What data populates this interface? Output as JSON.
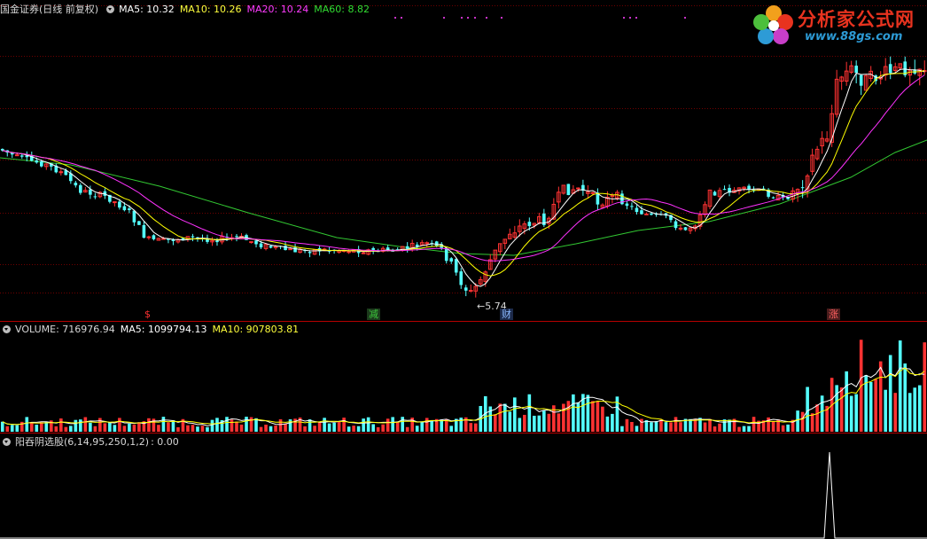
{
  "main_header": {
    "title": "国金证券(日线 前复权)",
    "ma5": "MA5: 10.32",
    "ma10": "MA10: 10.26",
    "ma20": "MA20: 10.24",
    "ma60": "MA60: 8.82"
  },
  "vol_header": {
    "title": "VOLUME: 716976.94",
    "ma5": "MA5: 1099794.13",
    "ma10": "MA10: 907803.81"
  },
  "ind_header": {
    "title": "阳吞阴选股(6,14,95,250,1,2)",
    "value": ": 0.00"
  },
  "low_annotation": "←5.74",
  "signals": [
    {
      "label": "$",
      "color": "#ff3232"
    },
    {
      "label": "减",
      "color": "#3cc83c"
    },
    {
      "label": "财",
      "color": "#5aa0ff"
    },
    {
      "label": "涨",
      "color": "#ff5050"
    }
  ],
  "logo": {
    "name": "分析家公式网",
    "url": "www.88gs.com"
  },
  "colors": {
    "up": "#ff3232",
    "down": "#54ffff",
    "ma5": "#ffffff",
    "ma10": "#ffff00",
    "ma20": "#ff32ff",
    "ma60": "#32c832",
    "grid": "#8b0000"
  },
  "chart_data": {
    "type": "candlestick",
    "price_summary": {
      "low_marked": 5.74,
      "ma5_last": 10.32,
      "ma10_last": 10.26,
      "ma20_last": 10.24,
      "ma60_last": 8.82
    },
    "volume_summary": {
      "last_volume": 716976.94,
      "ma5_last": 1099794.13,
      "ma10_last": 907803.81
    },
    "indicator": {
      "name": "阳吞阴选股",
      "params": [
        6,
        14,
        95,
        250,
        1,
        2
      ],
      "last_value": 0.0,
      "spike_value": 1
    }
  }
}
